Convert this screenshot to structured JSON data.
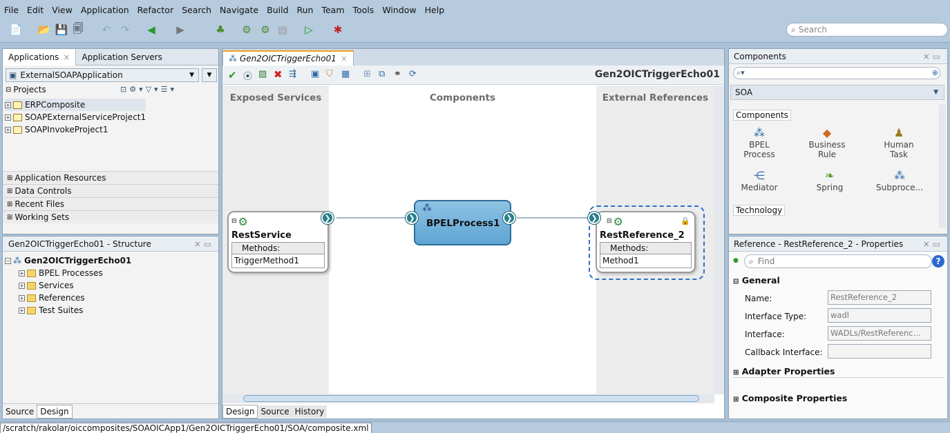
{
  "menu": [
    "File",
    "Edit",
    "View",
    "Application",
    "Refactor",
    "Search",
    "Navigate",
    "Build",
    "Run",
    "Team",
    "Tools",
    "Window",
    "Help"
  ],
  "toolbar": {
    "search_placeholder": "Search"
  },
  "apps_panel": {
    "tabs": [
      "Applications",
      "Application Servers"
    ],
    "app_selector": "ExternalSOAPApplication",
    "projects_label": "Projects",
    "projects": [
      "ERPComposite",
      "SOAPExternalServiceProject1",
      "SOAPInvokeProject1"
    ],
    "accordions": [
      "Application Resources",
      "Data Controls",
      "Recent Files",
      "Working Sets"
    ]
  },
  "structure_panel": {
    "title": "Gen2OICTriggerEcho01 - Structure",
    "root": "Gen2OICTriggerEcho01",
    "children": [
      "BPEL Processes",
      "Services",
      "References",
      "Test Suites"
    ],
    "tabs": [
      "Source",
      "Design"
    ]
  },
  "editor": {
    "tab": "Gen2OICTriggerEcho01",
    "heading": "Gen2OICTriggerEcho01",
    "columns": [
      "Exposed Services",
      "Components",
      "External References"
    ],
    "service": {
      "name": "RestService",
      "methods_label": "Methods:",
      "method": "TriggerMethod1"
    },
    "process": {
      "name": "BPELProcess1"
    },
    "reference": {
      "name": "RestReference_2",
      "methods_label": "Methods:",
      "method": "Method1"
    },
    "bottom_tabs": [
      "Design",
      "Source",
      "History"
    ]
  },
  "components_panel": {
    "title": "Components",
    "category": "SOA",
    "section_components": "Components",
    "items": [
      {
        "label1": "BPEL",
        "label2": "Process",
        "icon": "bpel-icon"
      },
      {
        "label1": "Business",
        "label2": "Rule",
        "icon": "rule-icon"
      },
      {
        "label1": "Human",
        "label2": "Task",
        "icon": "human-task-icon"
      },
      {
        "label1": "Mediator",
        "label2": "",
        "icon": "mediator-icon"
      },
      {
        "label1": "Spring",
        "label2": "",
        "icon": "spring-icon"
      },
      {
        "label1": "Subproce...",
        "label2": "",
        "icon": "subprocess-icon"
      }
    ],
    "section_technology": "Technology"
  },
  "properties_panel": {
    "title": "Reference - RestReference_2 - Properties",
    "find_placeholder": "Find",
    "general": "General",
    "fields": [
      {
        "label": "Name:",
        "value": "RestReference_2"
      },
      {
        "label": "Interface Type:",
        "value": "wadl"
      },
      {
        "label": "Interface:",
        "value": "WADLs/RestReferenc..."
      },
      {
        "label": "Callback Interface:",
        "value": ""
      }
    ],
    "adapter": "Adapter Properties",
    "composite": "Composite Properties"
  },
  "status_bar": {
    "path": "/scratch/rakolar/oiccomposites/SOAOICApp1/Gen2OICTriggerEcho01/SOA/composite.xml"
  }
}
